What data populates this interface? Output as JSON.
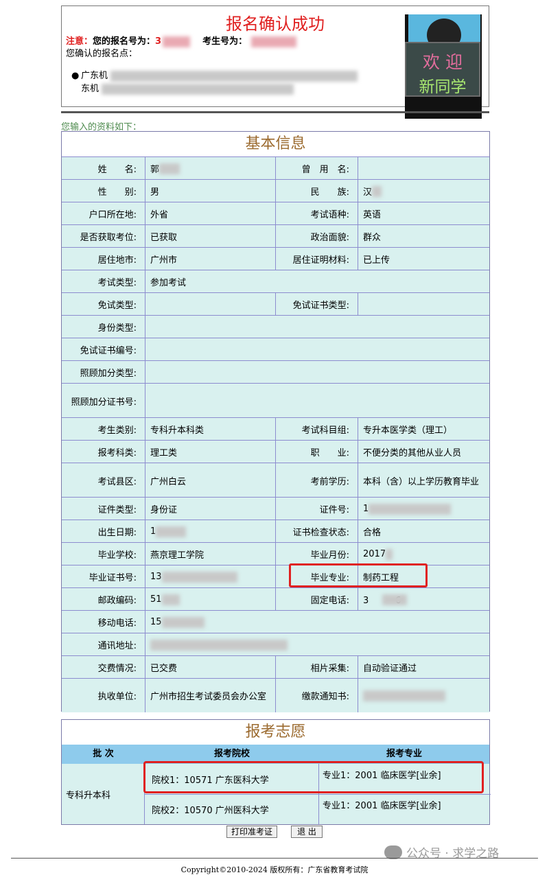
{
  "confirm": {
    "title": "报名确认成功",
    "notice_label": "注意：",
    "reg_no_label": "您的报名号为：",
    "reg_no_prefix": "3",
    "exam_no_label": "考生号为：",
    "points_label": "您确认的报名点：",
    "point_line1": "广东机",
    "point_line2": "东机"
  },
  "photo": {
    "welcome_line1": "欢 迎",
    "welcome_line2": "新同学"
  },
  "intro": "您输入的资料如下：",
  "basic": {
    "title": "基本信息",
    "rows": [
      {
        "l1": "姓　　名:",
        "v1": "郭",
        "l2": "曾　用　名:",
        "v2": ""
      },
      {
        "l1": "性　　别:",
        "v1": "男",
        "l2": "民　　族:",
        "v2": "汉"
      },
      {
        "l1": "户口所在地:",
        "v1": "外省",
        "l2": "考试语种:",
        "v2": "英语"
      },
      {
        "l1": "是否获取考位:",
        "v1": "已获取",
        "l2": "政治面貌:",
        "v2": "群众"
      },
      {
        "l1": "居住地市:",
        "v1": "广州市",
        "l2": "居住证明材料:",
        "v2": "已上传"
      },
      {
        "l1": "考试类型:",
        "v1": "参加考试"
      },
      {
        "l1": "免试类型:",
        "v1": "",
        "l2": "免试证书类型:",
        "v2": ""
      },
      {
        "l1": "身份类型:",
        "v1": ""
      },
      {
        "l1": "免试证书编号:",
        "v1": ""
      },
      {
        "l1": "照顾加分类型:",
        "v1": ""
      },
      {
        "l1": "照顾加分证书号:",
        "v1": ""
      },
      {
        "l1": "考生类别:",
        "v1": "专科升本科类",
        "l2": "考试科目组:",
        "v2": "专升本医学类（理工）"
      },
      {
        "l1": "报考科类:",
        "v1": "理工类",
        "l2": "职　　业:",
        "v2": "不便分类的其他从业人员"
      },
      {
        "l1": "考试县区:",
        "v1": "广州白云",
        "l2": "考前学历:",
        "v2": "本科（含）以上学历教育毕业"
      },
      {
        "l1": "证件类型:",
        "v1": "身份证",
        "l2": "证件号:",
        "v2": "1"
      },
      {
        "l1": "出生日期:",
        "v1": "1",
        "l2": "证书检查状态:",
        "v2": "合格"
      },
      {
        "l1": "毕业学校:",
        "v1": "燕京理工学院",
        "l2": "毕业月份:",
        "v2": "2017"
      },
      {
        "l1": "毕业证书号:",
        "v1": "13",
        "l2": "毕业专业:",
        "v2": "制药工程"
      },
      {
        "l1": "邮政编码:",
        "v1": "51",
        "l2": "固定电话:",
        "v2": "3　　　6"
      },
      {
        "l1": "移动电话:",
        "v1": "15"
      },
      {
        "l1": "通讯地址:",
        "v1": ""
      },
      {
        "l1": "交费情况:",
        "v1": "已交费",
        "l2": "相片采集:",
        "v2": "自动验证通过"
      },
      {
        "l1": "执收单位:",
        "v1": "广州市招生考试委员会办公室",
        "l2": "缴款通知书:",
        "v2": ""
      }
    ]
  },
  "volunteer": {
    "title": "报考志愿",
    "headers": [
      "批 次",
      "报考院校",
      "报考专业"
    ],
    "batch": "专科升本科",
    "entries": [
      {
        "school": "院校1：10571 广东医科大学",
        "major": "专业1：2001 临床医学[业余]"
      },
      {
        "school": "院校2：10570 广州医科大学",
        "major": "专业1：2001 临床医学[业余]"
      }
    ]
  },
  "buttons": {
    "print": "打印准考证",
    "exit": "退 出"
  },
  "copyright": "Copyright©2010-2024 版权所有：广东省教育考试院",
  "watermark": "公众号 · 求学之路"
}
